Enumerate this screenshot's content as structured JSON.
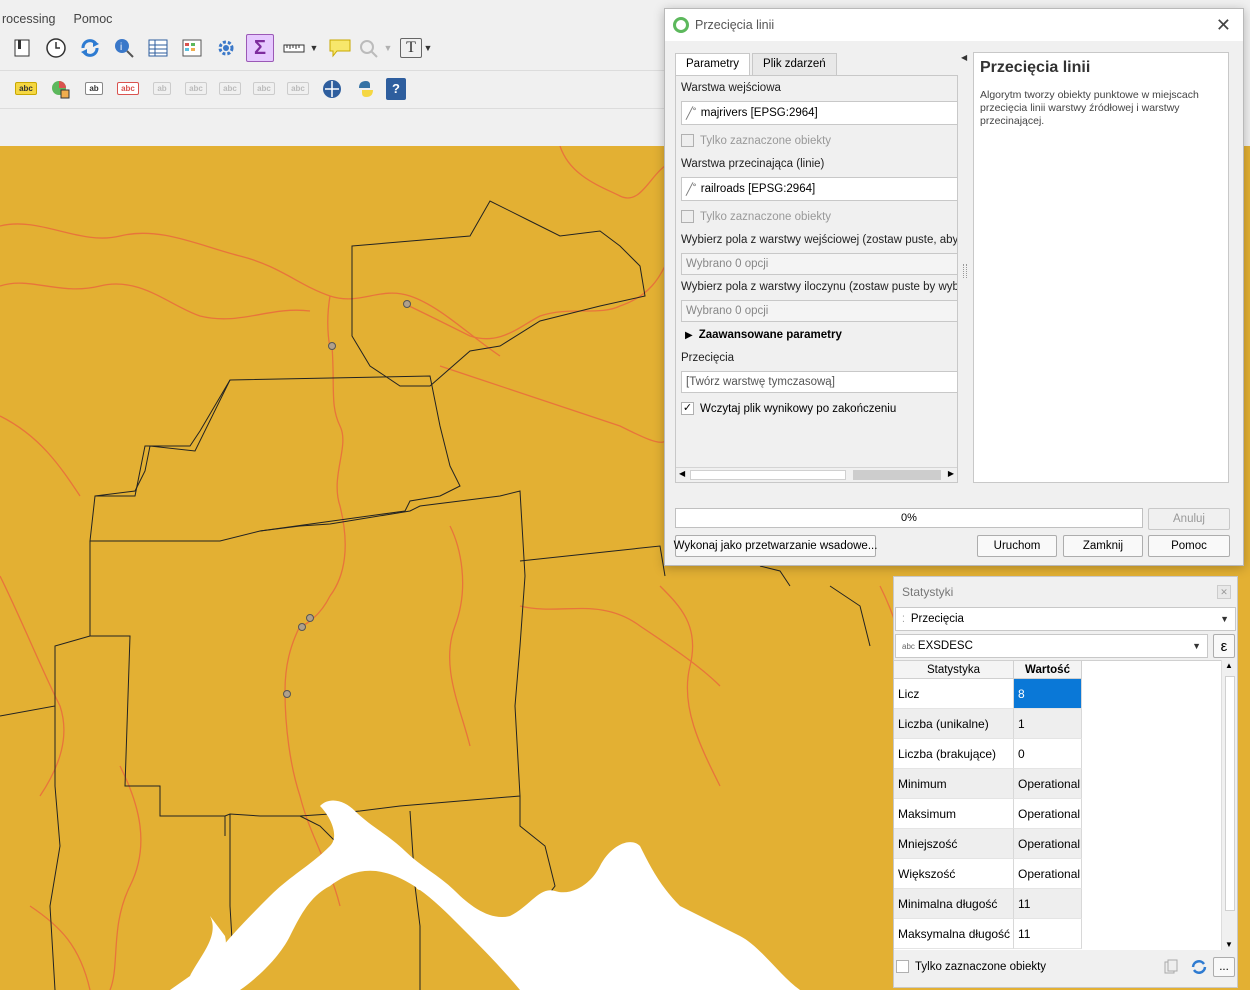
{
  "menubar": {
    "processing": "rocessing",
    "help": "Pomoc"
  },
  "toolbar": {
    "abc1": "abc",
    "abc2": "abc",
    "abc3": "ab",
    "abc4": "abc",
    "dis1": "ab",
    "dis2": "abc",
    "dis3": "abc",
    "dis4": "abc",
    "dis5": "abc",
    "sigma": "Σ",
    "text_tool": "T",
    "help": "?"
  },
  "dialog": {
    "title": "Przecięcia linii",
    "tabs": [
      "Parametry",
      "Plik zdarzeń"
    ],
    "input_layer_label": "Warstwa wejściowa",
    "input_layer_value": "majrivers [EPSG:2964]",
    "selected_only_1": "Tylko zaznaczone obiekty",
    "intersect_layer_label": "Warstwa przecinająca (linie)",
    "intersect_layer_value": "railroads [EPSG:2964]",
    "selected_only_2": "Tylko zaznaczone obiekty",
    "input_fields_label": "Wybierz pola z warstwy wejściowej (zostaw puste, aby w",
    "input_fields_value": "Wybrano 0 opcji",
    "intersect_fields_label": "Wybierz pola z warstwy iloczynu (zostaw puste by wybra",
    "intersect_fields_value": "Wybrano 0 opcji",
    "advanced_label": "Zaawansowane parametry",
    "output_label": "Przecięcia",
    "output_placeholder": "[Twórz warstwę tymczasową]",
    "open_output_label": "Wczytaj plik wynikowy po zakończeniu",
    "open_output_checked": true,
    "help_title": "Przecięcia linii",
    "help_body": "Algorytm tworzy obiekty punktowe w miejscach przecięcia linii warstwy źródłowej i warstwy przecinającej.",
    "progress_text": "0%",
    "progress_value": 0,
    "cancel_label": "Anuluj",
    "batch_label": "Wykonaj jako przetwarzanie wsadowe...",
    "run_label": "Uruchom",
    "close_label": "Zamknij",
    "help_label": "Pomoc"
  },
  "stats": {
    "title": "Statystyki",
    "layer": "Przecięcia",
    "field_type": "abc",
    "field": "EXSDESC",
    "expr_icon": "ε",
    "col_stat": "Statystyka",
    "col_value": "Wartość",
    "rows": [
      {
        "stat": "Licz",
        "value": "8"
      },
      {
        "stat": "Liczba (unikalne)",
        "value": "1"
      },
      {
        "stat": "Liczba (brakujące)",
        "value": "0"
      },
      {
        "stat": "Minimum",
        "value": "Operational"
      },
      {
        "stat": "Maksimum",
        "value": "Operational"
      },
      {
        "stat": "Mniejszość",
        "value": "Operational"
      },
      {
        "stat": "Większość",
        "value": "Operational"
      },
      {
        "stat": "Minimalna długość",
        "value": "11"
      },
      {
        "stat": "Maksymalna długość",
        "value": "11"
      }
    ],
    "selected_only": "Tylko zaznaczone obiekty",
    "more": "..."
  },
  "colors": {
    "map_fill": "#e3b033",
    "river": "#e8743b",
    "border": "#222222",
    "water": "#ffffff",
    "selection": "#0a78d7"
  }
}
